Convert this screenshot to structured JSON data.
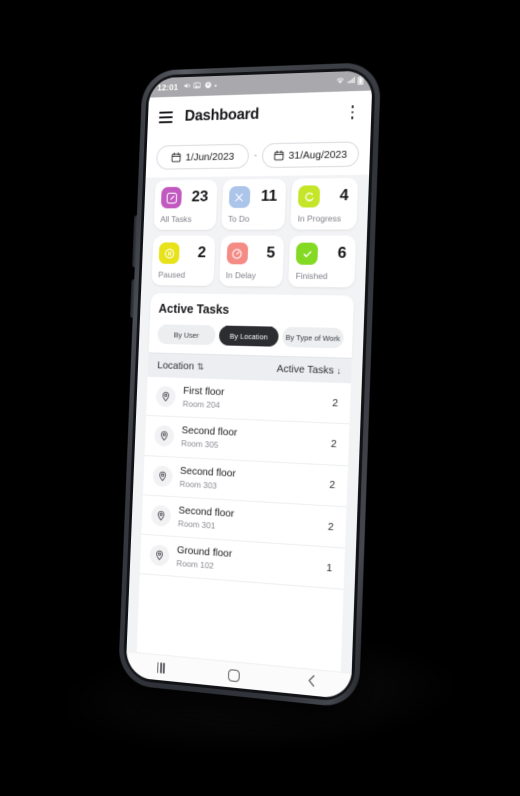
{
  "status_bar": {
    "clock": "12:01",
    "left_icons": [
      "mute-icon",
      "image-icon",
      "privacy-icon",
      "dot-icon"
    ],
    "right_icons": [
      "wifi-icon",
      "signal-icon",
      "battery-icon"
    ]
  },
  "header": {
    "menu_icon": "hamburger-icon",
    "title": "Dashboard",
    "more_icon": "kebab-menu-icon"
  },
  "date_range": {
    "start": "1/Jun/2023",
    "separator": "-",
    "end": "31/Aug/2023"
  },
  "stats": [
    {
      "label": "All Tasks",
      "value": "23",
      "color": "#c159c0",
      "icon": "edit-square-icon"
    },
    {
      "label": "To Do",
      "value": "11",
      "color": "#abc4ea",
      "icon": "tools-icon"
    },
    {
      "label": "In Progress",
      "value": "4",
      "color": "#c4e528",
      "icon": "refresh-circle-icon"
    },
    {
      "label": "Paused",
      "value": "2",
      "color": "#e8e21a",
      "icon": "pause-circle-icon"
    },
    {
      "label": "In Delay",
      "value": "5",
      "color": "#f48b85",
      "icon": "gauge-icon"
    },
    {
      "label": "Finished",
      "value": "6",
      "color": "#84d922",
      "icon": "check-icon"
    }
  ],
  "panel": {
    "title": "Active Tasks",
    "segments": [
      {
        "label": "By User",
        "active": false
      },
      {
        "label": "By Location",
        "active": true
      },
      {
        "label": "By Type of Work",
        "active": false
      }
    ]
  },
  "table": {
    "columns": [
      {
        "label": "Location",
        "sort_icon": "⇅"
      },
      {
        "label": "Active Tasks",
        "sort_icon": "↓"
      }
    ],
    "rows": [
      {
        "title": "First floor",
        "sub": "Room 204",
        "count": "2"
      },
      {
        "title": "Second floor",
        "sub": "Room 305",
        "count": "2"
      },
      {
        "title": "Second floor",
        "sub": "Room 303",
        "count": "2"
      },
      {
        "title": "Second floor",
        "sub": "Room 301",
        "count": "2"
      },
      {
        "title": "Ground floor",
        "sub": "Room 102",
        "count": "1"
      }
    ]
  },
  "nav_bar": {
    "recents_icon": "recents-icon",
    "home_icon": "home-icon",
    "back_icon": "back-icon"
  }
}
